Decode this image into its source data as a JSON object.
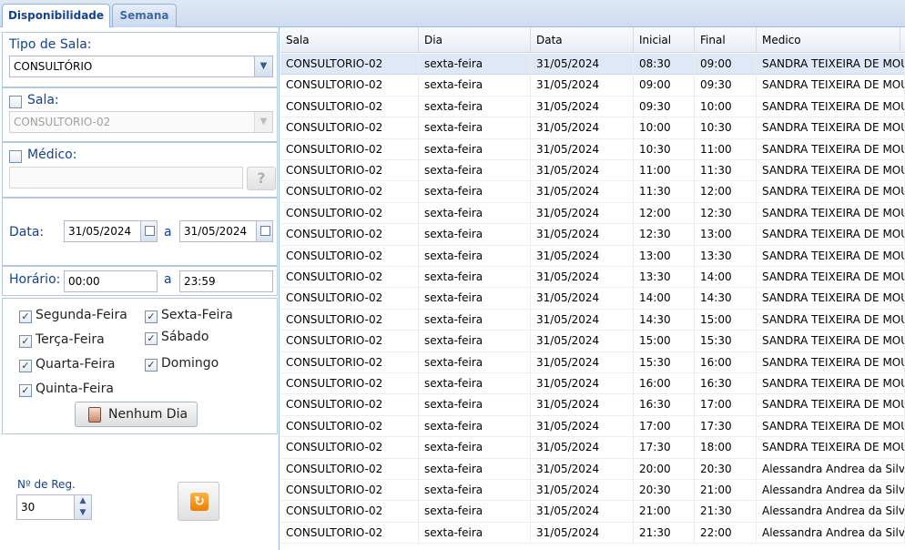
{
  "tabs": [
    {
      "label": "Disponibilidade"
    },
    {
      "label": "Semana"
    }
  ],
  "filters": {
    "tipo_sala_label": "Tipo de Sala:",
    "tipo_sala_value": "CONSULTÓRIO",
    "sala_label": "Sala:",
    "sala_value": "CONSULTORIO-02",
    "medico_label": "Médico:",
    "medico_value": "",
    "data_label": "Data:",
    "data_from": "31/05/2024",
    "data_sep": "a",
    "data_to": "31/05/2024",
    "horario_label": "Horário:",
    "horario_from": "00:00",
    "horario_sep": "a",
    "horario_to": "23:59",
    "help_glyph": "?",
    "days": [
      {
        "label": "Segunda-Feira",
        "checked": true
      },
      {
        "label": "Sexta-Feira",
        "checked": true
      },
      {
        "label": "Terça-Feira",
        "checked": true
      },
      {
        "label": "Sábado",
        "checked": true
      },
      {
        "label": "Quarta-Feira",
        "checked": true
      },
      {
        "label": "Domingo",
        "checked": true
      },
      {
        "label": "Quinta-Feira",
        "checked": true
      }
    ],
    "nenhum_dia_label": "Nenhum Dia",
    "nreg_label": "Nº de Reg.",
    "nreg_value": "30"
  },
  "grid": {
    "columns": [
      "Sala",
      "Dia",
      "Data",
      "Inicial",
      "Final",
      "Medico"
    ],
    "rows": [
      [
        "CONSULTORIO-02",
        "sexta-feira",
        "31/05/2024",
        "08:30",
        "09:00",
        "SANDRA TEIXEIRA DE MOUR"
      ],
      [
        "CONSULTORIO-02",
        "sexta-feira",
        "31/05/2024",
        "09:00",
        "09:30",
        "SANDRA TEIXEIRA DE MOUR"
      ],
      [
        "CONSULTORIO-02",
        "sexta-feira",
        "31/05/2024",
        "09:30",
        "10:00",
        "SANDRA TEIXEIRA DE MOUR"
      ],
      [
        "CONSULTORIO-02",
        "sexta-feira",
        "31/05/2024",
        "10:00",
        "10:30",
        "SANDRA TEIXEIRA DE MOUR"
      ],
      [
        "CONSULTORIO-02",
        "sexta-feira",
        "31/05/2024",
        "10:30",
        "11:00",
        "SANDRA TEIXEIRA DE MOUR"
      ],
      [
        "CONSULTORIO-02",
        "sexta-feira",
        "31/05/2024",
        "11:00",
        "11:30",
        "SANDRA TEIXEIRA DE MOUR"
      ],
      [
        "CONSULTORIO-02",
        "sexta-feira",
        "31/05/2024",
        "11:30",
        "12:00",
        "SANDRA TEIXEIRA DE MOUR"
      ],
      [
        "CONSULTORIO-02",
        "sexta-feira",
        "31/05/2024",
        "12:00",
        "12:30",
        "SANDRA TEIXEIRA DE MOUR"
      ],
      [
        "CONSULTORIO-02",
        "sexta-feira",
        "31/05/2024",
        "12:30",
        "13:00",
        "SANDRA TEIXEIRA DE MOUR"
      ],
      [
        "CONSULTORIO-02",
        "sexta-feira",
        "31/05/2024",
        "13:00",
        "13:30",
        "SANDRA TEIXEIRA DE MOUR"
      ],
      [
        "CONSULTORIO-02",
        "sexta-feira",
        "31/05/2024",
        "13:30",
        "14:00",
        "SANDRA TEIXEIRA DE MOUR"
      ],
      [
        "CONSULTORIO-02",
        "sexta-feira",
        "31/05/2024",
        "14:00",
        "14:30",
        "SANDRA TEIXEIRA DE MOUR"
      ],
      [
        "CONSULTORIO-02",
        "sexta-feira",
        "31/05/2024",
        "14:30",
        "15:00",
        "SANDRA TEIXEIRA DE MOUR"
      ],
      [
        "CONSULTORIO-02",
        "sexta-feira",
        "31/05/2024",
        "15:00",
        "15:30",
        "SANDRA TEIXEIRA DE MOUR"
      ],
      [
        "CONSULTORIO-02",
        "sexta-feira",
        "31/05/2024",
        "15:30",
        "16:00",
        "SANDRA TEIXEIRA DE MOUR"
      ],
      [
        "CONSULTORIO-02",
        "sexta-feira",
        "31/05/2024",
        "16:00",
        "16:30",
        "SANDRA TEIXEIRA DE MOUR"
      ],
      [
        "CONSULTORIO-02",
        "sexta-feira",
        "31/05/2024",
        "16:30",
        "17:00",
        "SANDRA TEIXEIRA DE MOUR"
      ],
      [
        "CONSULTORIO-02",
        "sexta-feira",
        "31/05/2024",
        "17:00",
        "17:30",
        "SANDRA TEIXEIRA DE MOUR"
      ],
      [
        "CONSULTORIO-02",
        "sexta-feira",
        "31/05/2024",
        "17:30",
        "18:00",
        "SANDRA TEIXEIRA DE MOUR"
      ],
      [
        "CONSULTORIO-02",
        "sexta-feira",
        "31/05/2024",
        "20:00",
        "20:30",
        "Alessandra Andrea da Silva"
      ],
      [
        "CONSULTORIO-02",
        "sexta-feira",
        "31/05/2024",
        "20:30",
        "21:00",
        "Alessandra Andrea da Silva"
      ],
      [
        "CONSULTORIO-02",
        "sexta-feira",
        "31/05/2024",
        "21:00",
        "21:30",
        "Alessandra Andrea da Silva"
      ],
      [
        "CONSULTORIO-02",
        "sexta-feira",
        "31/05/2024",
        "21:30",
        "22:00",
        "Alessandra Andrea da Silva"
      ]
    ]
  }
}
